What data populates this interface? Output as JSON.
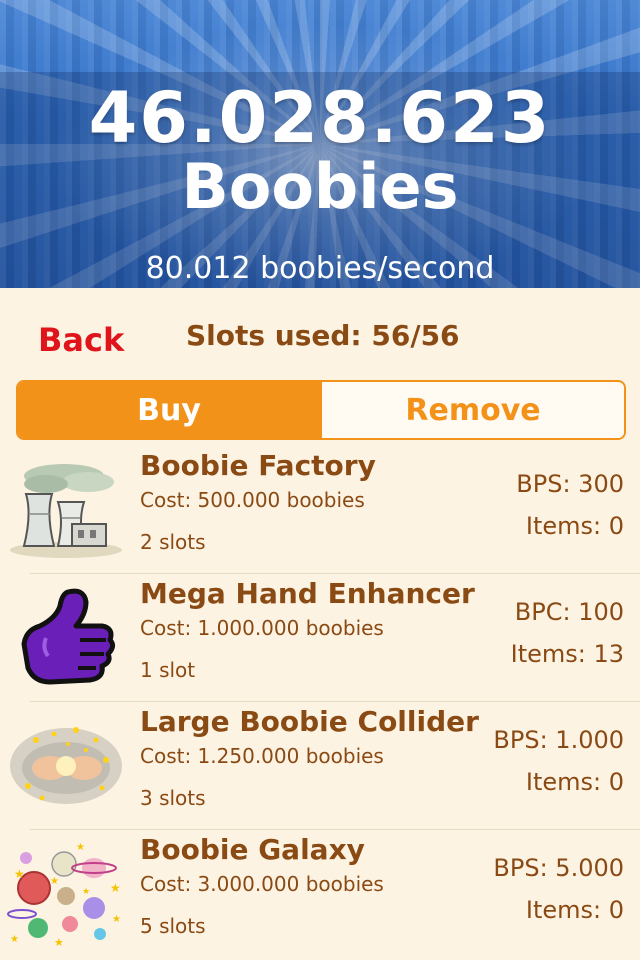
{
  "header": {
    "count": "46.028.623",
    "unit": "Boobies",
    "rate": "80.012 boobies/second"
  },
  "nav": {
    "back_label": "Back",
    "slots_label": "Slots used: 56/56"
  },
  "tabs": {
    "buy": "Buy",
    "remove": "Remove",
    "active": "buy"
  },
  "items": [
    {
      "name": "Boobie Factory",
      "cost": "Cost: 500.000 boobies",
      "slots": "2 slots",
      "stat": "BPS: 300",
      "count": "Items: 0",
      "icon": "factory-icon"
    },
    {
      "name": "Mega Hand Enhancer",
      "cost": "Cost: 1.000.000 boobies",
      "slots": "1 slot",
      "stat": "BPC: 100",
      "count": "Items: 13",
      "icon": "thumbs-up-icon"
    },
    {
      "name": "Large Boobie Collider",
      "cost": "Cost: 1.250.000 boobies",
      "slots": "3 slots",
      "stat": "BPS: 1.000",
      "count": "Items: 0",
      "icon": "collider-icon"
    },
    {
      "name": "Boobie Galaxy",
      "cost": "Cost: 3.000.000 boobies",
      "slots": "5 slots",
      "stat": "BPS: 5.000",
      "count": "Items: 0",
      "icon": "galaxy-icon"
    }
  ],
  "colors": {
    "accent": "#f39219",
    "text": "#8a4a14",
    "back": "#e0141b",
    "header_blue": "#2f6fc7",
    "background": "#fdf3e3"
  }
}
